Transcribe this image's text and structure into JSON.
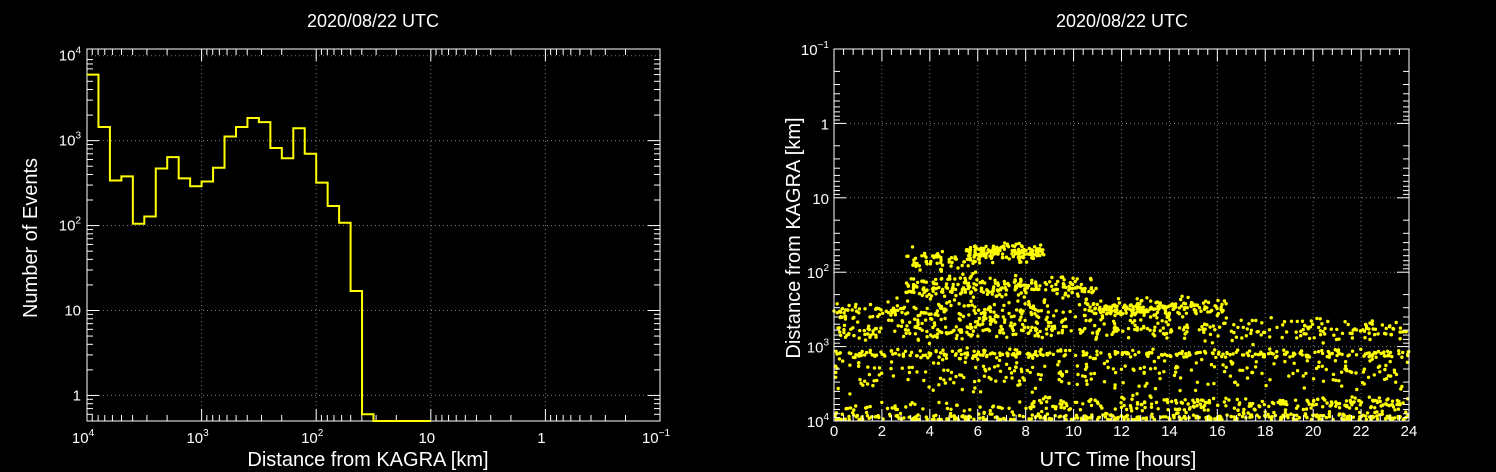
{
  "chart_data": [
    {
      "type": "histogram",
      "title": "2020/08/22 UTC",
      "xlabel": "Distance from KAGRA [km]",
      "ylabel": "Number of Events",
      "x_scale": "log",
      "x_reversed": true,
      "y_scale": "log",
      "xlim": [
        10000,
        0.1
      ],
      "ylim": [
        0.5,
        12000
      ],
      "x_ticks": [
        {
          "v": 10000,
          "b": "10",
          "e": "4"
        },
        {
          "v": 1000,
          "b": "10",
          "e": "3"
        },
        {
          "v": 100,
          "b": "10",
          "e": "2"
        },
        {
          "v": 10,
          "b": "10",
          "e": ""
        },
        {
          "v": 1,
          "b": "1",
          "e": ""
        },
        {
          "v": 0.1,
          "b": "10",
          "e": "−1"
        }
      ],
      "y_ticks": [
        {
          "v": 1,
          "b": "1",
          "e": ""
        },
        {
          "v": 10,
          "b": "10",
          "e": ""
        },
        {
          "v": 100,
          "b": "10",
          "e": "2"
        },
        {
          "v": 1000,
          "b": "10",
          "e": "3"
        },
        {
          "v": 10000,
          "b": "10",
          "e": "4"
        }
      ],
      "grid": true,
      "line_color": "#ffff00",
      "bins": {
        "edges": [
          10000,
          7943,
          6310,
          5012,
          3981,
          3162,
          2512,
          1995,
          1585,
          1259,
          1000,
          794.3,
          631.0,
          501.2,
          398.1,
          316.2,
          251.2,
          199.5,
          158.5,
          125.9,
          100,
          79.43,
          63.1,
          50.12,
          39.81,
          31.62,
          25.12,
          19.95,
          15.85,
          12.59,
          10
        ],
        "counts": [
          6000,
          1450,
          340,
          380,
          105,
          128,
          470,
          640,
          360,
          290,
          330,
          480,
          1120,
          1450,
          1850,
          1650,
          820,
          620,
          1400,
          700,
          320,
          170,
          108,
          17,
          0.6,
          0,
          0,
          0,
          0,
          0
        ]
      }
    },
    {
      "type": "scatter",
      "title": "2020/08/22 UTC",
      "xlabel": "UTC Time [hours]",
      "ylabel": "Distance from KAGRA [km]",
      "x_scale": "linear",
      "y_scale": "log",
      "y_reversed": true,
      "xlim": [
        0,
        24
      ],
      "ylim": [
        0.1,
        10000
      ],
      "x_ticks": [
        "0",
        "2",
        "4",
        "6",
        "8",
        "10",
        "12",
        "14",
        "16",
        "18",
        "20",
        "22",
        "24"
      ],
      "y_ticks": [
        {
          "v": 0.1,
          "b": "10",
          "e": "−1"
        },
        {
          "v": 1,
          "b": "1",
          "e": ""
        },
        {
          "v": 10,
          "b": "10",
          "e": ""
        },
        {
          "v": 100,
          "b": "10",
          "e": "2"
        },
        {
          "v": 1000,
          "b": "10",
          "e": "3"
        },
        {
          "v": 10000,
          "b": "10",
          "e": "4"
        }
      ],
      "grid": true,
      "marker_color": "#ffff00",
      "bands": [
        {
          "t0": 0,
          "t1": 24,
          "dist": 9000,
          "spread": 0.06,
          "n": 340
        },
        {
          "t0": 0.5,
          "t1": 24,
          "dist": 6500,
          "spread": 0.08,
          "n": 150
        },
        {
          "t0": 8,
          "t1": 24,
          "dist": 5500,
          "spread": 0.08,
          "n": 130
        },
        {
          "t0": 0,
          "t1": 24,
          "dist": 2300,
          "spread": 0.22,
          "n": 260
        },
        {
          "t0": 0,
          "t1": 24,
          "dist": 1250,
          "spread": 0.06,
          "n": 300
        },
        {
          "t0": 0,
          "t1": 24,
          "dist": 600,
          "spread": 0.14,
          "n": 360
        },
        {
          "t0": 0,
          "t1": 14,
          "dist": 340,
          "spread": 0.14,
          "n": 260
        },
        {
          "t0": 10.5,
          "t1": 16.5,
          "dist": 300,
          "spread": 0.12,
          "n": 140
        },
        {
          "t0": 3,
          "t1": 11,
          "dist": 160,
          "spread": 0.14,
          "n": 240
        },
        {
          "t0": 5.5,
          "t1": 8.8,
          "dist": 55,
          "spread": 0.12,
          "n": 160
        },
        {
          "t0": 3,
          "t1": 6,
          "dist": 70,
          "spread": 0.16,
          "n": 60
        }
      ]
    }
  ]
}
